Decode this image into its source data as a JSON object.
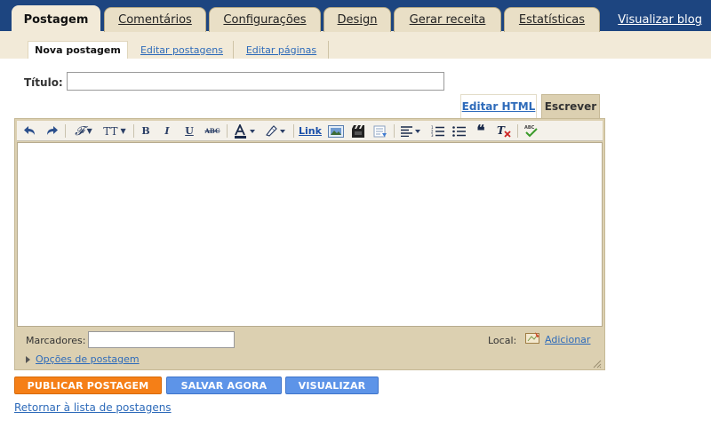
{
  "tabs": [
    {
      "label": "Postagem",
      "active": true
    },
    {
      "label": "Comentários",
      "active": false
    },
    {
      "label": "Configurações",
      "active": false
    },
    {
      "label": "Design",
      "active": false
    },
    {
      "label": "Gerar receita",
      "active": false
    },
    {
      "label": "Estatísticas",
      "active": false
    }
  ],
  "view_blog_label": "Visualizar blog",
  "subtabs": [
    {
      "label": "Nova postagem",
      "active": true
    },
    {
      "label": "Editar postagens",
      "active": false
    },
    {
      "label": "Editar páginas",
      "active": false
    }
  ],
  "title_field": {
    "label": "Título:",
    "value": ""
  },
  "editor_modes": {
    "html": "Editar HTML",
    "write": "Escrever"
  },
  "toolbar": {
    "undo": "undo-icon",
    "redo": "redo-icon",
    "font": "font-family-icon",
    "font_size": "font-size-icon",
    "bold": "B",
    "italic": "I",
    "underline": "U",
    "strike": "ABC",
    "text_color": "text-color-icon",
    "highlight": "highlight-icon",
    "link": "Link",
    "image": "image-icon",
    "video": "video-icon",
    "jump_break": "jump-break-icon",
    "align": "align-icon",
    "ordered_list": "ordered-list-icon",
    "bullet_list": "bullet-list-icon",
    "quote": "quote-icon",
    "clear_format": "clear-format-icon",
    "spellcheck": "spellcheck-icon"
  },
  "body_content": "",
  "labels_field": {
    "label": "Marcadores:",
    "value": ""
  },
  "location": {
    "label": "Local:",
    "add_label": "Adicionar"
  },
  "post_options_label": "Opções de postagem",
  "buttons": {
    "publish": "PUBLICAR POSTAGEM",
    "save": "SALVAR AGORA",
    "preview": "VISUALIZAR"
  },
  "back_link_label": "Retornar à lista de postagens",
  "colors": {
    "topbar": "#1d4580",
    "tab": "#e9dfc6",
    "active_tab": "#f2ead8",
    "publish": "#f57f17",
    "save": "#5d94e8",
    "link": "#2e6bba"
  }
}
